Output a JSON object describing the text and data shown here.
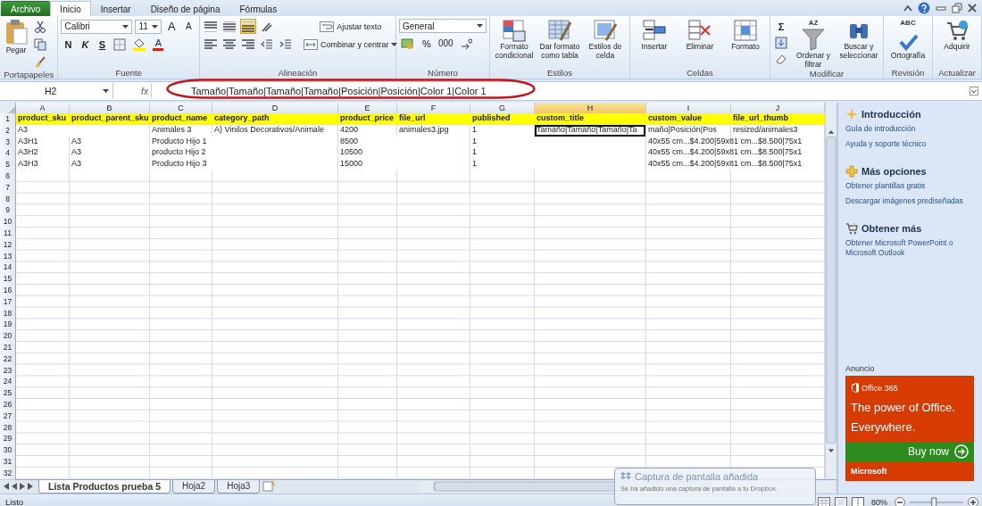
{
  "ribbon_tabs": [
    {
      "label": "Archivo",
      "kind": "file",
      "selected": false
    },
    {
      "label": "Inicio",
      "kind": "tab",
      "selected": true
    },
    {
      "label": "Insertar",
      "kind": "tab",
      "selected": false
    },
    {
      "label": "Diseño de página",
      "kind": "tab",
      "selected": false
    },
    {
      "label": "Fórmulas",
      "kind": "tab",
      "selected": false
    }
  ],
  "ribbon": {
    "clipboard": {
      "label": "Portapapeles",
      "paste": "Pegar"
    },
    "font": {
      "label": "Fuente",
      "name": "Calibri",
      "size": "11",
      "grow": "A",
      "shrink": "A",
      "bold": "N",
      "italic": "K",
      "underline": "S",
      "color_letter": "A"
    },
    "alignment": {
      "label": "Alineación",
      "buttons": [
        {
          "kind": "top",
          "selected": false
        },
        {
          "kind": "middle",
          "selected": false
        },
        {
          "kind": "bottom",
          "selected": true
        },
        {
          "kind": "left",
          "selected": false
        },
        {
          "kind": "center",
          "selected": false
        },
        {
          "kind": "right",
          "selected": false
        }
      ],
      "wrap_text": "Ajustar texto",
      "merge": "Combinar y centrar"
    },
    "number": {
      "label": "Número",
      "format": "General",
      "percent": "%",
      "thousands": "000"
    },
    "groups": [
      {
        "label": "Estilos",
        "buttons": [
          {
            "label": "Formato condicional",
            "kind": "conditional"
          },
          {
            "label": "Dar formato como tabla",
            "kind": "table"
          },
          {
            "label": "Estilos de celda",
            "kind": "cellstyle"
          }
        ]
      },
      {
        "label": "Celdas",
        "buttons": [
          {
            "label": "Insertar",
            "kind": "insert"
          },
          {
            "label": "Eliminar",
            "kind": "delete"
          },
          {
            "label": "Formato",
            "kind": "format"
          }
        ]
      },
      {
        "label": "Modificar",
        "sum": "Σ",
        "buttons": [
          {
            "label": "Ordenar y filtrar",
            "kind": "sort",
            "icon_text": "AZ"
          },
          {
            "label": "Buscar y seleccionar",
            "kind": "find"
          }
        ]
      },
      {
        "label": "Revisión",
        "buttons": [
          {
            "label": "Ortografía",
            "kind": "spell",
            "icon_text": "ABC"
          }
        ]
      },
      {
        "label": "Actualizar",
        "buttons": [
          {
            "label": "Adquirir",
            "kind": "cart"
          }
        ]
      }
    ]
  },
  "formula_bar": {
    "name_box": "H2",
    "function_label": "fx",
    "formula": "Tamaño|Tamaño|Tamaño|Tamaño|Posición|Posición|Color 1|Color 1"
  },
  "grid": {
    "columns": [
      {
        "letter": "A",
        "selected": false
      },
      {
        "letter": "B",
        "selected": false
      },
      {
        "letter": "C",
        "selected": false
      },
      {
        "letter": "D",
        "selected": false
      },
      {
        "letter": "E",
        "selected": false
      },
      {
        "letter": "F",
        "selected": false
      },
      {
        "letter": "G",
        "selected": false
      },
      {
        "letter": "H",
        "selected": true
      },
      {
        "letter": "I",
        "selected": false
      },
      {
        "letter": "J",
        "selected": false
      }
    ],
    "rows": [
      {
        "number": "1",
        "highlighted": true,
        "cells": {
          "A": {
            "text": "product_sku",
            "active": false
          },
          "B": {
            "text": "product_parent_sku",
            "active": false
          },
          "C": {
            "text": "product_name",
            "active": false
          },
          "D": {
            "text": "category_path",
            "active": false
          },
          "E": {
            "text": "product_price",
            "active": false
          },
          "F": {
            "text": "file_url",
            "active": false
          },
          "G": {
            "text": "published",
            "active": false
          },
          "H": {
            "text": "custom_title",
            "active": false
          },
          "I": {
            "text": "custom_value",
            "active": false
          },
          "J": {
            "text": "file_url_thumb",
            "active": false
          }
        }
      },
      {
        "number": "2",
        "highlighted": false,
        "cells": {
          "A": {
            "text": "A3",
            "active": false
          },
          "C": {
            "text": "Animales 3",
            "active": false
          },
          "D": {
            "text": "A) Vinilos Decorativos/Animale",
            "active": false
          },
          "E": {
            "text": "4200",
            "active": false
          },
          "F": {
            "text": "animales3.jpg",
            "active": false
          },
          "G": {
            "text": "1",
            "active": false
          },
          "H": {
            "text": "Tamaño|Tamaño|Tamaño|Ta",
            "active": true
          },
          "I": {
            "text": "maño|Posición|Pos",
            "active": false
          },
          "J": {
            "text": "resized/animales3",
            "active": false
          }
        }
      },
      {
        "number": "3",
        "highlighted": false,
        "cells": {
          "A": {
            "text": "A3H1",
            "active": false
          },
          "B": {
            "text": "A3",
            "active": false
          },
          "C": {
            "text": "Producto Hijo 1",
            "active": false
          },
          "E": {
            "text": "8500",
            "active": false
          },
          "G": {
            "text": "1",
            "active": false
          },
          "I": {
            "text": "40x55 cm...$4.200|59x81 cm...$8.500|75x1",
            "active": false
          }
        }
      },
      {
        "number": "4",
        "highlighted": false,
        "cells": {
          "A": {
            "text": "A3H2",
            "active": false
          },
          "B": {
            "text": "A3",
            "active": false
          },
          "C": {
            "text": "producto Hijo 2",
            "active": false
          },
          "E": {
            "text": "10500",
            "active": false
          },
          "G": {
            "text": "1",
            "active": false
          },
          "I": {
            "text": "40x55 cm...$4.200|59x81 cm...$8.500|75x1",
            "active": false
          }
        }
      },
      {
        "number": "5",
        "highlighted": false,
        "cells": {
          "A": {
            "text": "A3H3",
            "active": false
          },
          "B": {
            "text": "A3",
            "active": false
          },
          "C": {
            "text": "Producto Hijo 3",
            "active": false
          },
          "E": {
            "text": "15000",
            "active": false
          },
          "G": {
            "text": "1",
            "active": false
          },
          "I": {
            "text": "40x55 cm...$4.200|59x81 cm...$8.500|75x1",
            "active": false
          }
        }
      },
      {
        "number": "6",
        "highlighted": false
      },
      {
        "number": "7",
        "highlighted": false
      },
      {
        "number": "8",
        "highlighted": false
      },
      {
        "number": "9",
        "highlighted": false
      },
      {
        "number": "10",
        "highlighted": false
      },
      {
        "number": "11",
        "highlighted": false
      },
      {
        "number": "12",
        "highlighted": false
      },
      {
        "number": "13",
        "highlighted": false
      },
      {
        "number": "14",
        "highlighted": false
      },
      {
        "number": "15",
        "highlighted": false
      },
      {
        "number": "16",
        "highlighted": false
      },
      {
        "number": "17",
        "highlighted": false
      },
      {
        "number": "18",
        "highlighted": false
      },
      {
        "number": "19",
        "highlighted": false
      },
      {
        "number": "20",
        "highlighted": false
      },
      {
        "number": "21",
        "highlighted": false
      },
      {
        "number": "22",
        "highlighted": false
      },
      {
        "number": "23",
        "highlighted": false
      },
      {
        "number": "24",
        "highlighted": false
      },
      {
        "number": "25",
        "highlighted": false
      },
      {
        "number": "26",
        "highlighted": false
      },
      {
        "number": "27",
        "highlighted": false
      },
      {
        "number": "28",
        "highlighted": false
      },
      {
        "number": "29",
        "highlighted": false
      },
      {
        "number": "30",
        "highlighted": false
      },
      {
        "number": "31",
        "highlighted": false
      },
      {
        "number": "32",
        "highlighted": false
      }
    ]
  },
  "sheet_tabs": [
    {
      "label": "Lista Productos prueba 5",
      "selected": true
    },
    {
      "label": "Hoja2",
      "selected": false
    },
    {
      "label": "Hoja3",
      "selected": false
    }
  ],
  "task_pane": {
    "sections": [
      {
        "title": "Introducción",
        "kind": "sparkle",
        "links": [
          "Guía de introducción",
          "Ayuda y soporte técnico"
        ]
      },
      {
        "title": "Más opciones",
        "kind": "plus",
        "links": [
          "Obtener plantillas gratis",
          "Descargar imágenes prediseñadas"
        ]
      },
      {
        "title": "Obtener más",
        "kind": "cart",
        "links": [
          "Obtener Microsoft PowerPoint o Microsoft Outlook"
        ]
      }
    ],
    "ad": {
      "label": "Anuncio",
      "brand": "Office 365",
      "headline": "The power of Office. Everywhere.",
      "button": "Buy now",
      "footer": "Microsoft"
    }
  },
  "status_bar": {
    "text": "Listo",
    "zoom": "80%",
    "slider": {
      "level": 0.45
    }
  },
  "notification": {
    "title": "Captura de pantalla añadida",
    "message": "Se ha añadido una captura de pantalla a tu Dropbox."
  }
}
